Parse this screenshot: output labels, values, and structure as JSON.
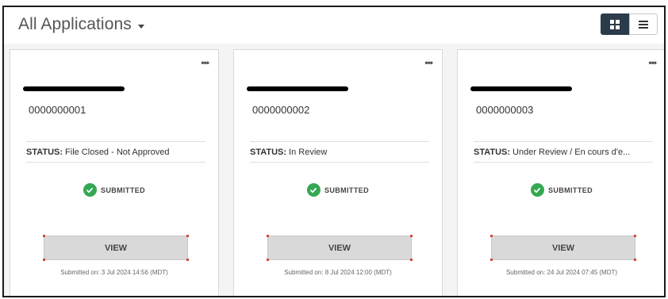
{
  "header": {
    "title": "All Applications",
    "view_modes": [
      {
        "name": "grid",
        "active": true,
        "icon": "grid-icon"
      },
      {
        "name": "list",
        "active": false,
        "icon": "list-icon"
      }
    ]
  },
  "colors": {
    "accent_dark": "#2b3b4c",
    "success": "#34a853",
    "button_bg": "#d9d9d9",
    "corner_marker": "#d04848"
  },
  "cards": [
    {
      "app_number": "0000000001",
      "status_label": "STATUS:",
      "status_value": "File Closed - Not Approved",
      "badge": "SUBMITTED",
      "view_label": "VIEW",
      "submitted_on": "Submitted on: 3 Jul 2024 14:56 (MDT)"
    },
    {
      "app_number": "0000000002",
      "status_label": "STATUS:",
      "status_value": "In Review",
      "badge": "SUBMITTED",
      "view_label": "VIEW",
      "submitted_on": "Submitted on: 8 Jul 2024 12:00 (MDT)"
    },
    {
      "app_number": "0000000003",
      "status_label": "STATUS:",
      "status_value": "Under Review / En cours d'e...",
      "badge": "SUBMITTED",
      "view_label": "VIEW",
      "submitted_on": "Submitted on: 24 Jul 2024 07:45 (MDT)"
    }
  ]
}
